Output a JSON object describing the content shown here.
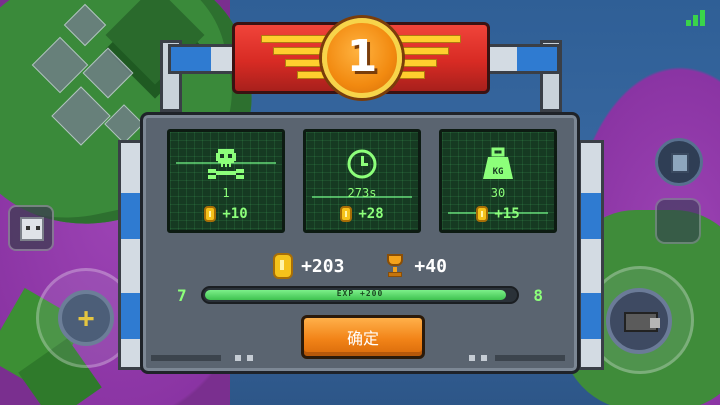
{
  "hud": {
    "signal_icon": "signal-bars-icon",
    "left_button_icon": "plus-icon",
    "left_button_symbol": "+",
    "right_button_icon": "gun-icon",
    "companion_icon": "cube-pet-icon",
    "inventory_icon": "trash-bin-icon"
  },
  "badge": {
    "rank": "1",
    "wing_icon": "wings-icon"
  },
  "stats": [
    {
      "icon": "skull-crossbones-icon",
      "value": "1",
      "reward": "+10"
    },
    {
      "icon": "clock-icon",
      "value": "273s",
      "reward": "+28"
    },
    {
      "icon": "weight-kg-icon",
      "value": "30",
      "reward": "+15"
    }
  ],
  "weight_icon_text": "KG",
  "summary": {
    "coins": "+203",
    "trophy": "+40"
  },
  "level": {
    "current": "7",
    "next": "8",
    "exp_label": "EXP +200",
    "progress": 0.97
  },
  "confirm_label": "确定",
  "colors": {
    "accent_green": "#8cff7a",
    "badge_red": "#d82b24",
    "button_orange": "#f28418",
    "gold": "#f5c21b"
  }
}
